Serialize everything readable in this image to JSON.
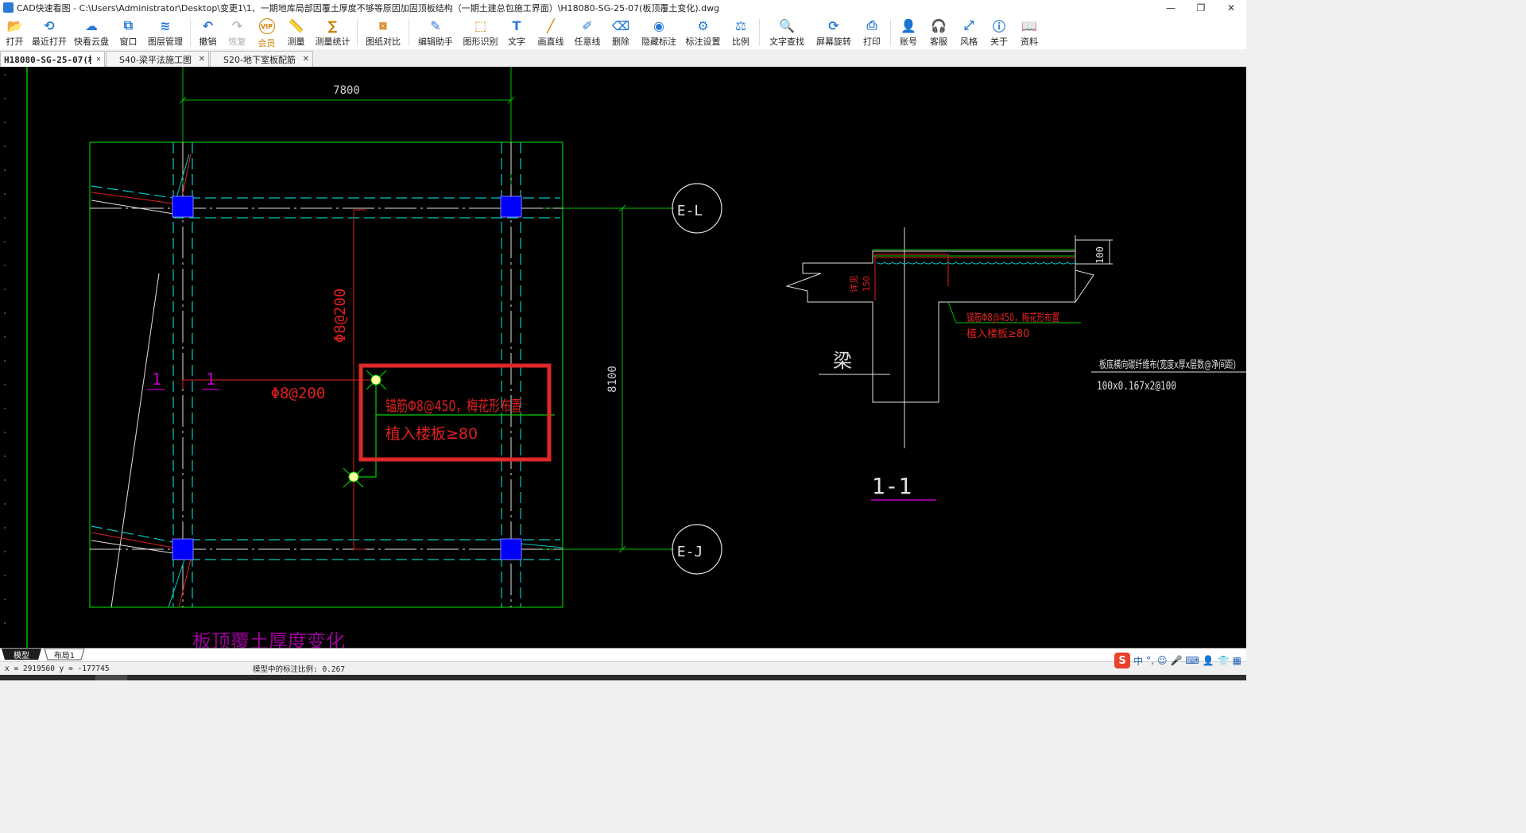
{
  "window": {
    "title": "CAD快速看图 - C:\\Users\\Administrator\\Desktop\\变更1\\1、一期地库局部因覆土厚度不够等原因加固顶板结构（一期土建总包施工界面）\\H18080-SG-25-07(板顶覆土变化).dwg",
    "minimize": "—",
    "restore": "❐",
    "close": "✕"
  },
  "toolbar": {
    "items": [
      {
        "name": "open",
        "label": "打开",
        "icon": "folder-icon",
        "color": "#2a7ad5"
      },
      {
        "name": "recent",
        "label": "最近打开",
        "icon": "clock-icon",
        "color": "#2a7ad5"
      },
      {
        "name": "cloud",
        "label": "快看云盘",
        "icon": "cloud-icon",
        "color": "#2a7ad5"
      },
      {
        "name": "window",
        "label": "窗口",
        "icon": "window-icon",
        "color": "#2a7ad5"
      },
      {
        "name": "layers",
        "label": "图层管理",
        "icon": "layers-icon",
        "color": "#2a7ad5"
      },
      {
        "name": "undo",
        "label": "撤销",
        "icon": "undo-icon",
        "color": "#2a7ad5"
      },
      {
        "name": "redo",
        "label": "恢复",
        "icon": "redo-icon",
        "color": "#bbbbbb",
        "dim": true
      },
      {
        "name": "vip",
        "label": "会员",
        "icon": "vip-icon",
        "color": "#d08000",
        "vip": true
      },
      {
        "name": "measure",
        "label": "测量",
        "icon": "ruler-icon",
        "color": "#2a7ad5"
      },
      {
        "name": "measure-stats",
        "label": "测量统计",
        "icon": "stats-icon",
        "color": "#d08000"
      },
      {
        "name": "compare",
        "label": "图纸对比",
        "icon": "compare-icon",
        "color": "#d08000"
      },
      {
        "name": "edit-assist",
        "label": "编辑助手",
        "icon": "edit-assist-icon",
        "color": "#2a7ad5"
      },
      {
        "name": "shape-recog",
        "label": "图形识别",
        "icon": "shape-recognize-icon",
        "color": "#d08000"
      },
      {
        "name": "text",
        "label": "文字",
        "icon": "text-icon",
        "color": "#2a7ad5"
      },
      {
        "name": "line",
        "label": "画直线",
        "icon": "line-icon",
        "color": "#d08000"
      },
      {
        "name": "freeline",
        "label": "任意线",
        "icon": "pen-icon",
        "color": "#2a7ad5"
      },
      {
        "name": "delete",
        "label": "删除",
        "icon": "eraser-icon",
        "color": "#2a7ad5"
      },
      {
        "name": "hide-annot",
        "label": "隐藏标注",
        "icon": "eye-icon",
        "color": "#2a7ad5"
      },
      {
        "name": "annot-settings",
        "label": "标注设置",
        "icon": "settings-icon",
        "color": "#2a7ad5"
      },
      {
        "name": "scale",
        "label": "比例",
        "icon": "scale-icon",
        "color": "#2a7ad5"
      },
      {
        "name": "text-find",
        "label": "文字查找",
        "icon": "text-search-icon",
        "color": "#2a7ad5"
      },
      {
        "name": "rotate",
        "label": "屏幕旋转",
        "icon": "rotate-icon",
        "color": "#2a7ad5"
      },
      {
        "name": "print",
        "label": "打印",
        "icon": "printer-icon",
        "color": "#2a7ad5"
      },
      {
        "name": "account",
        "label": "账号",
        "icon": "user-icon",
        "color": "#2a7ad5"
      },
      {
        "name": "support",
        "label": "客服",
        "icon": "headset-icon",
        "color": "#2a7ad5"
      },
      {
        "name": "style",
        "label": "风格",
        "icon": "style-icon",
        "color": "#2a7ad5"
      },
      {
        "name": "about",
        "label": "关于",
        "icon": "info-icon",
        "color": "#2a7ad5"
      },
      {
        "name": "docs",
        "label": "资料",
        "icon": "book-icon",
        "color": "#2a7ad5"
      }
    ]
  },
  "tabs": [
    {
      "label": "H18080-SG-25-07(板…",
      "active": true,
      "close": "✕"
    },
    {
      "label": "S40-梁平法施工图",
      "active": false,
      "close": "✕"
    },
    {
      "label": "S20-地下室板配筋",
      "active": false,
      "close": "✕"
    }
  ],
  "drawing": {
    "dim_top": "7800",
    "dim_right": "8100",
    "axis_top": "E-L",
    "axis_bottom": "E-J",
    "rebar_vertical": "Φ8@200",
    "rebar_horizontal": "Φ8@200",
    "section_mark_left": "1",
    "section_mark_right": "1",
    "highlight_line1": "锚筋Φ8@450，梅花形布置",
    "highlight_line2": "植入楼板≥80",
    "section_title": "1-1",
    "beam_label": "梁",
    "section_note1": "锚筋Φ8@450，梅花形布置",
    "section_note2": "植入楼板≥80",
    "section_dim": "100",
    "side_note": "详见",
    "side_value": "150",
    "cfrp_title": "板底横向碳纤维布(宽度x厚x层数@净间距)",
    "cfrp_value": "100x0.167x2@100",
    "bottom_text": "板顶覆土厚度变化"
  },
  "layout_tabs": [
    {
      "label": "模型",
      "active": true
    },
    {
      "label": "布局1",
      "active": false
    }
  ],
  "status": {
    "coords": "x = 2919560  y = -177745",
    "scale_text": "模型中的标注比例: 0.267"
  },
  "ime": {
    "logo": "S",
    "lang": "中",
    "punct": "°,",
    "emoji": "☺",
    "mic": "🎤",
    "keyboard": "⌨",
    "user": "👤",
    "shirt": "👕",
    "grid": "▦"
  }
}
